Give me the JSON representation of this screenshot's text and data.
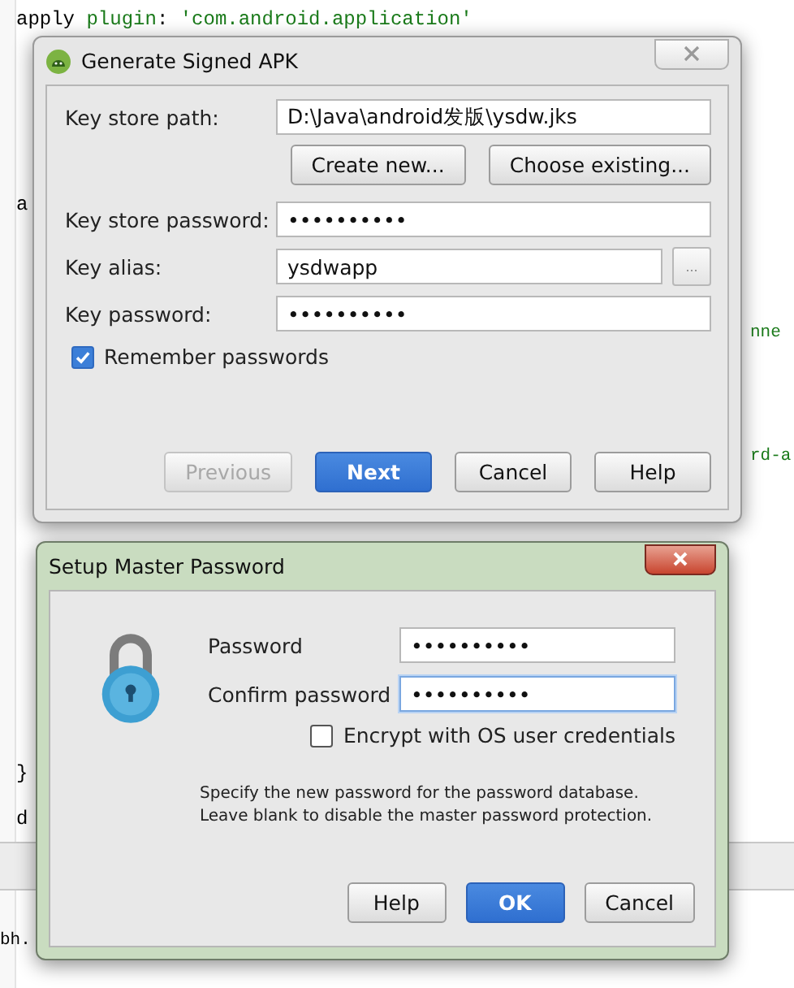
{
  "editor": {
    "lines": [
      {
        "segments": [
          {
            "text": "apply",
            "kind": "plain"
          },
          {
            "text": " plugin",
            "kind": "green"
          },
          {
            "text": ": ",
            "kind": "plain"
          },
          {
            "text": "'com.android.application'",
            "kind": "green"
          }
        ]
      },
      {
        "segments": [
          {
            "text": "a",
            "kind": "plain"
          }
        ]
      },
      {
        "segments": [
          {
            "text": "nne",
            "kind": "green"
          }
        ]
      },
      {
        "segments": [
          {
            "text": "rd-a",
            "kind": "green"
          }
        ]
      },
      {
        "segments": [
          {
            "text": "}",
            "kind": "plain"
          }
        ]
      },
      {
        "segments": [
          {
            "text": "d",
            "kind": "plain"
          }
        ]
      },
      {
        "segments": [
          {
            "text": "bh.",
            "kind": "plain"
          }
        ]
      }
    ]
  },
  "signed_apk_dialog": {
    "title": "Generate Signed APK",
    "fields": [
      {
        "label": "Key store path:",
        "value": "D:\\Java\\android发版\\ysdw.jks",
        "kind": "plain"
      },
      {
        "label": "Key store password:",
        "value": "••••••••••",
        "kind": "plain"
      },
      {
        "label": "Key alias:",
        "value": "ysdwapp",
        "kind": "browse",
        "browse_label": "..."
      },
      {
        "label": "Key password:",
        "value": "••••••••••",
        "kind": "plain"
      }
    ],
    "keystore_buttons": [
      "Create new...",
      "Choose existing..."
    ],
    "remember": {
      "label": "Remember passwords",
      "checked": true
    },
    "buttons": [
      {
        "label": "Previous",
        "disabled": true,
        "primary": false
      },
      {
        "label": "Next",
        "disabled": false,
        "primary": true
      },
      {
        "label": "Cancel",
        "disabled": false,
        "primary": false
      },
      {
        "label": "Help",
        "disabled": false,
        "primary": false
      }
    ]
  },
  "master_password_dialog": {
    "title": "Setup Master Password",
    "fields": [
      {
        "label": "Password",
        "value": "••••••••••",
        "focused": false
      },
      {
        "label": "Confirm password",
        "value": "••••••••••",
        "focused": true
      }
    ],
    "encrypt": {
      "label": "Encrypt with OS user credentials",
      "checked": false
    },
    "note": [
      "Specify the new password for the password database.",
      "Leave blank to disable the master password protection."
    ],
    "buttons": [
      {
        "label": "Help",
        "primary": false
      },
      {
        "label": "OK",
        "primary": true
      },
      {
        "label": "Cancel",
        "primary": false
      }
    ]
  }
}
